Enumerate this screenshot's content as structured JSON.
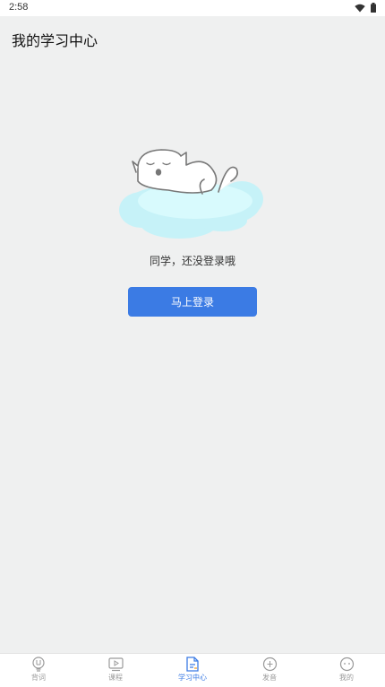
{
  "status_bar": {
    "time": "2:58",
    "icons": [
      "wifi-icon",
      "battery-icon"
    ]
  },
  "header": {
    "title": "我的学习中心"
  },
  "main": {
    "illustration": "sleeping-cat-on-cloud",
    "hint": "同学，还没登录哦",
    "login_button": "马上登录"
  },
  "tab_bar": {
    "active_index": 2,
    "items": [
      {
        "label": "背词",
        "icon": "lightbulb-icon"
      },
      {
        "label": "课程",
        "icon": "video-icon"
      },
      {
        "label": "学习中心",
        "icon": "document-icon"
      },
      {
        "label": "发音",
        "icon": "pronunciation-icon"
      },
      {
        "label": "我的",
        "icon": "profile-icon"
      }
    ]
  },
  "colors": {
    "accent": "#3b7be4",
    "background": "#eff0f0",
    "cloud": "#c9f6fb"
  }
}
